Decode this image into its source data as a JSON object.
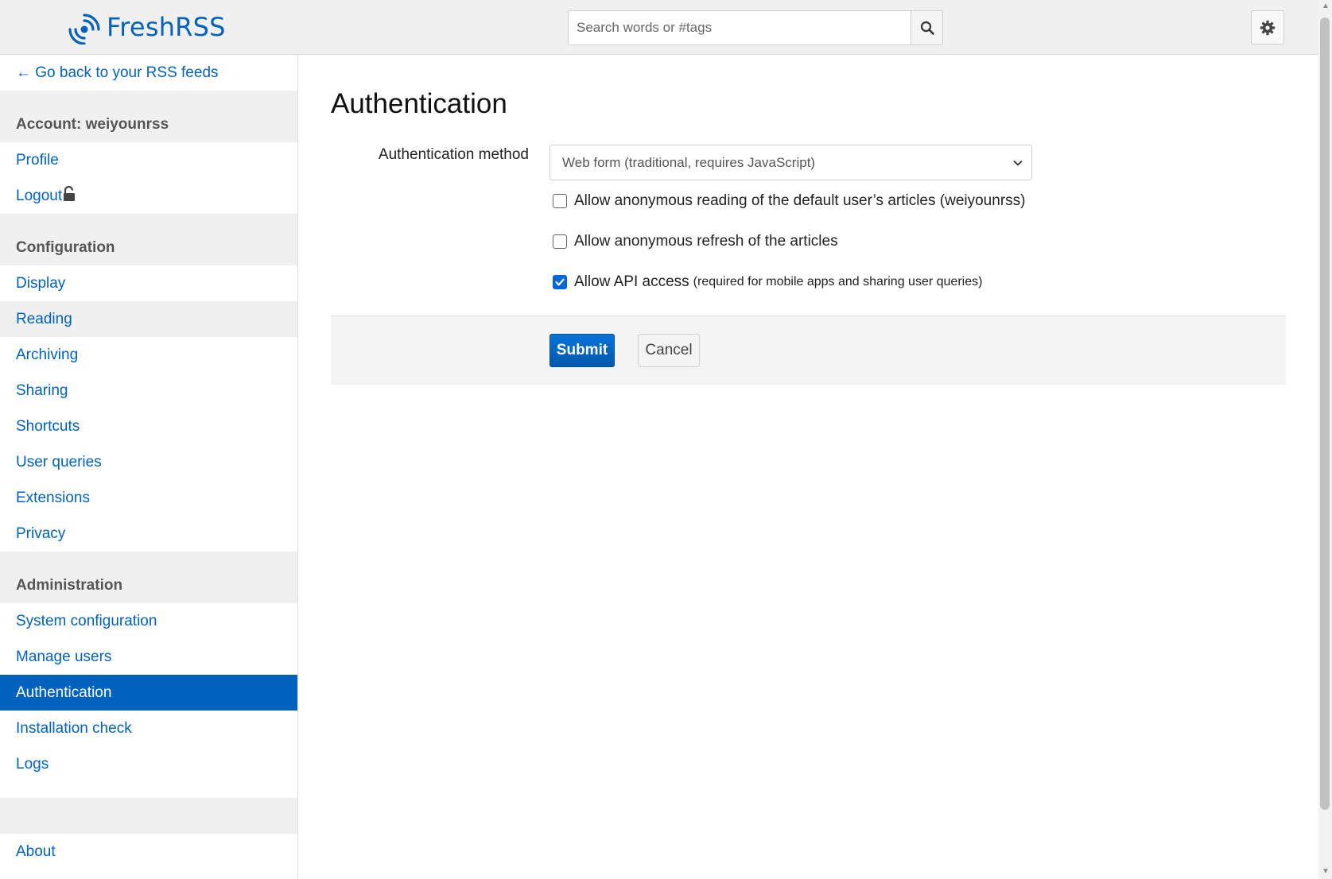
{
  "app": {
    "name": "FreshRSS"
  },
  "header": {
    "search_placeholder": "Search words or #tags"
  },
  "sidebar": {
    "back_link": "← Go back to your RSS feeds",
    "account_header": "Account: weiyounrss",
    "account_items": [
      "Profile",
      "Logout"
    ],
    "configuration_header": "Configuration",
    "configuration_items": [
      "Display",
      "Reading",
      "Archiving",
      "Sharing",
      "Shortcuts",
      "User queries",
      "Extensions",
      "Privacy"
    ],
    "administration_header": "Administration",
    "administration_items": [
      "System configuration",
      "Manage users",
      "Authentication",
      "Installation check",
      "Logs"
    ],
    "about": "About"
  },
  "main": {
    "title": "Authentication",
    "method_label": "Authentication method",
    "method_value": "Web form (traditional, requires JavaScript)",
    "checkboxes": [
      {
        "label": "Allow anonymous reading of the default user’s articles (weiyounrss)",
        "checked": false
      },
      {
        "label": "Allow anonymous refresh of the articles",
        "checked": false
      },
      {
        "label": "Allow API access",
        "note": "(required for mobile apps and sharing user queries)",
        "checked": true
      }
    ],
    "submit": "Submit",
    "cancel": "Cancel"
  },
  "colors": {
    "accent": "#0062be",
    "sidebar_header_bg": "#f0f0f0"
  }
}
